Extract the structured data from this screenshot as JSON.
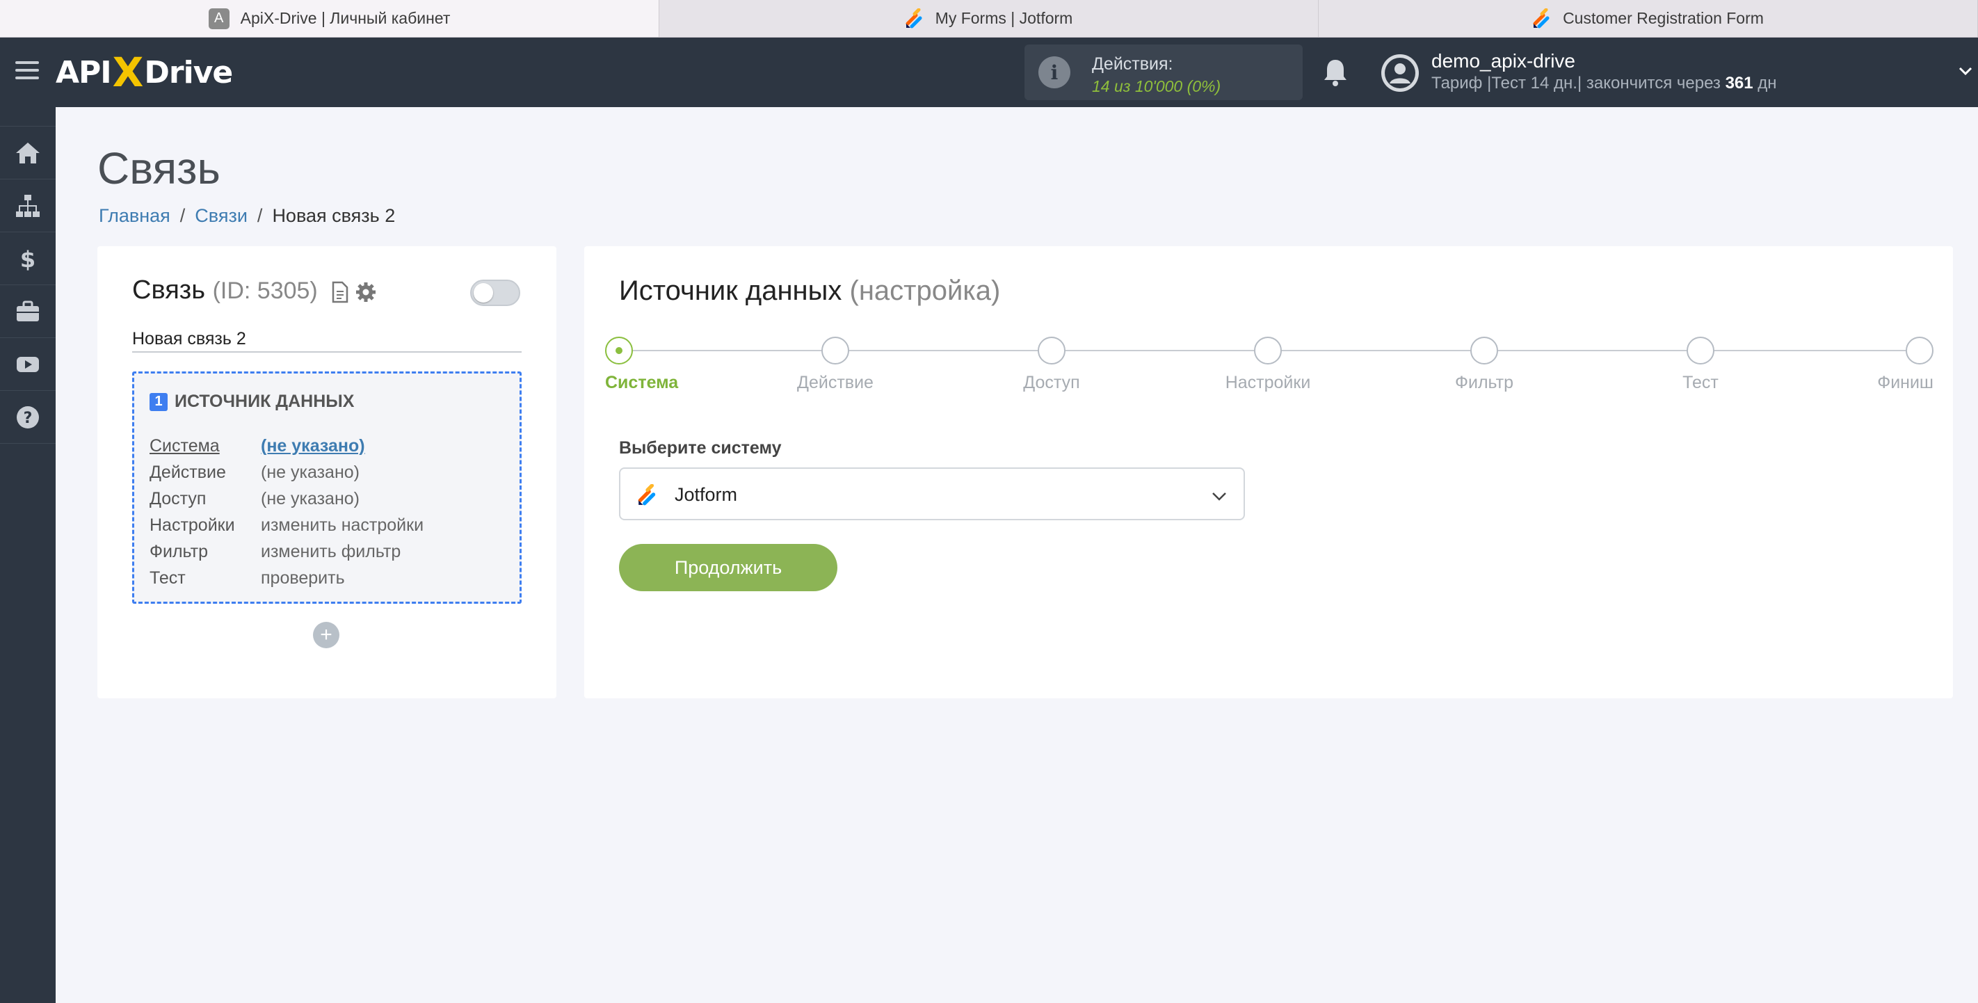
{
  "browser_tabs": [
    {
      "title": "ApiX-Drive | Личный кабинет",
      "icon": "A"
    },
    {
      "title": "My Forms | Jotform"
    },
    {
      "title": "Customer Registration Form"
    }
  ],
  "header": {
    "logo_left": "API",
    "logo_x": "X",
    "logo_right": "Drive",
    "actions_label": "Действия:",
    "actions_count": "14 из 10'000",
    "actions_pct": "(0%)",
    "user_name": "demo_apix-drive",
    "plan_prefix": "Тариф |Тест 14 дн.| закончится через",
    "plan_days": "361",
    "plan_suffix": "дн"
  },
  "sidebar": {
    "items": [
      "home-icon",
      "sitemap-icon",
      "dollar-icon",
      "briefcase-icon",
      "youtube-icon",
      "help-icon"
    ]
  },
  "page": {
    "title": "Связь",
    "breadcrumb": [
      "Главная",
      "Связи",
      "Новая связь 2"
    ]
  },
  "left_card": {
    "title": "Связь",
    "id_text": "(ID: 5305)",
    "connection_name": "Новая связь 2",
    "enabled": false,
    "source": {
      "number": "1",
      "heading": "ИСТОЧНИК ДАННЫХ",
      "rows": [
        {
          "key": "Система",
          "value": "(не указано)"
        },
        {
          "key": "Действие",
          "value": "(не указано)"
        },
        {
          "key": "Доступ",
          "value": "(не указано)"
        },
        {
          "key": "Настройки",
          "value": "изменить настройки"
        },
        {
          "key": "Фильтр",
          "value": "изменить фильтр"
        },
        {
          "key": "Тест",
          "value": "проверить"
        }
      ]
    },
    "add_label": "+"
  },
  "right_card": {
    "title": "Источник данных",
    "subtitle": "(настройка)",
    "steps": [
      "Система",
      "Действие",
      "Доступ",
      "Настройки",
      "Фильтр",
      "Тест",
      "Финиш"
    ],
    "active_step": 0,
    "select_label": "Выберите систему",
    "selected_system": "Jotform",
    "continue_label": "Продолжить"
  },
  "colors": {
    "accent_green": "#8cb455",
    "link_blue": "#3e7cb1",
    "dashed_blue": "#3e7ef0",
    "header_bg": "#2d3642"
  }
}
